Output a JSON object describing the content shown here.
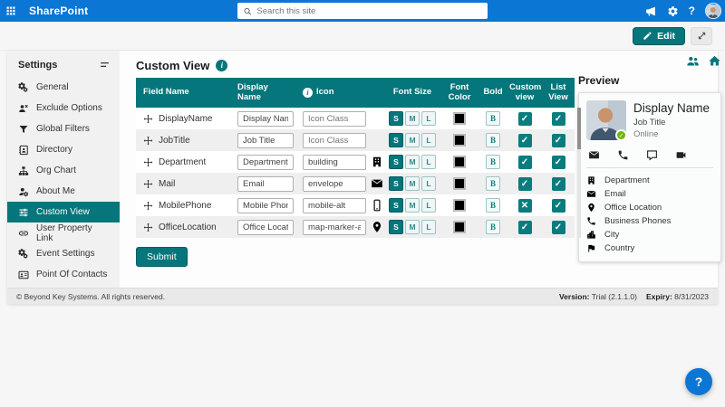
{
  "accent_color": "#05767b",
  "topbar": {
    "app_name": "SharePoint",
    "search_placeholder": "Search this site"
  },
  "toolbar": {
    "edit_label": "Edit"
  },
  "sidebar": {
    "title": "Settings",
    "items": [
      {
        "label": "General",
        "icon": "gears-icon"
      },
      {
        "label": "Exclude Options",
        "icon": "user-x-icon"
      },
      {
        "label": "Global Filters",
        "icon": "filter-icon"
      },
      {
        "label": "Directory",
        "icon": "address-book-icon"
      },
      {
        "label": "Org Chart",
        "icon": "sitemap-icon"
      },
      {
        "label": "About Me",
        "icon": "user-gear-icon"
      },
      {
        "label": "Custom View",
        "icon": "sliders-icon",
        "active": true
      },
      {
        "label": "User Property Link",
        "icon": "link-icon"
      },
      {
        "label": "Event Settings",
        "icon": "gears-icon"
      },
      {
        "label": "Point Of Contacts",
        "icon": "address-card-icon"
      }
    ]
  },
  "main": {
    "title": "Custom View",
    "submit_label": "Submit",
    "table": {
      "columns": [
        "Field Name",
        "Display Name",
        "Icon",
        "Font Size",
        "Font Color",
        "Bold",
        "Custom view",
        "List View"
      ],
      "size_options": [
        "S",
        "M",
        "L"
      ],
      "bold_label": "B",
      "rows": [
        {
          "field": "DisplayName",
          "display_name": "Display Name",
          "icon_value": "",
          "icon_placeholder": "Icon Class",
          "selected_size": "S",
          "font_color": "#000000",
          "custom_view_mark": "✓",
          "list_view_mark": "✓"
        },
        {
          "field": "JobTitle",
          "display_name": "Job Title",
          "icon_value": "",
          "icon_placeholder": "Icon Class",
          "selected_size": "S",
          "font_color": "#000000",
          "custom_view_mark": "✓",
          "list_view_mark": "✓"
        },
        {
          "field": "Department",
          "display_name": "Department",
          "icon_value": "building",
          "icon_placeholder": "Icon Class",
          "icon_name": "building-icon",
          "selected_size": "S",
          "font_color": "#000000",
          "custom_view_mark": "✓",
          "list_view_mark": "✓"
        },
        {
          "field": "Mail",
          "display_name": "Email",
          "icon_value": "envelope",
          "icon_placeholder": "Icon Class",
          "icon_name": "envelope-icon",
          "selected_size": "S",
          "font_color": "#000000",
          "custom_view_mark": "✓",
          "list_view_mark": "✓"
        },
        {
          "field": "MobilePhone",
          "display_name": "Mobile Phone",
          "icon_value": "mobile-alt",
          "icon_placeholder": "Icon Class",
          "icon_name": "mobile-icon",
          "selected_size": "S",
          "font_color": "#000000",
          "custom_view_mark": "✕",
          "list_view_mark": "✓"
        },
        {
          "field": "OfficeLocation",
          "display_name": "Office Location",
          "icon_value": "map-marker-alt",
          "icon_placeholder": "Icon Class",
          "icon_name": "map-marker-icon",
          "selected_size": "S",
          "font_color": "#000000",
          "custom_view_mark": "✓",
          "list_view_mark": "✓"
        }
      ]
    }
  },
  "preview": {
    "title": "Preview",
    "card": {
      "display_name": "Display Name",
      "job_title": "Job Title",
      "presence": "Online",
      "fields": [
        {
          "label": "Department",
          "icon": "building-icon"
        },
        {
          "label": "Email",
          "icon": "envelope-icon"
        },
        {
          "label": "Office Location",
          "icon": "map-marker-icon"
        },
        {
          "label": "Business Phones",
          "icon": "phone-icon"
        },
        {
          "label": "City",
          "icon": "city-icon"
        },
        {
          "label": "Country",
          "icon": "flag-icon"
        }
      ]
    }
  },
  "footer": {
    "copyright": "© Beyond Key Systems. All rights reserved.",
    "version_label": "Version:",
    "version_value": "Trial (2.1.1.0)",
    "expiry_label": "Expiry:",
    "expiry_value": "8/31/2023"
  },
  "help_label": "?"
}
